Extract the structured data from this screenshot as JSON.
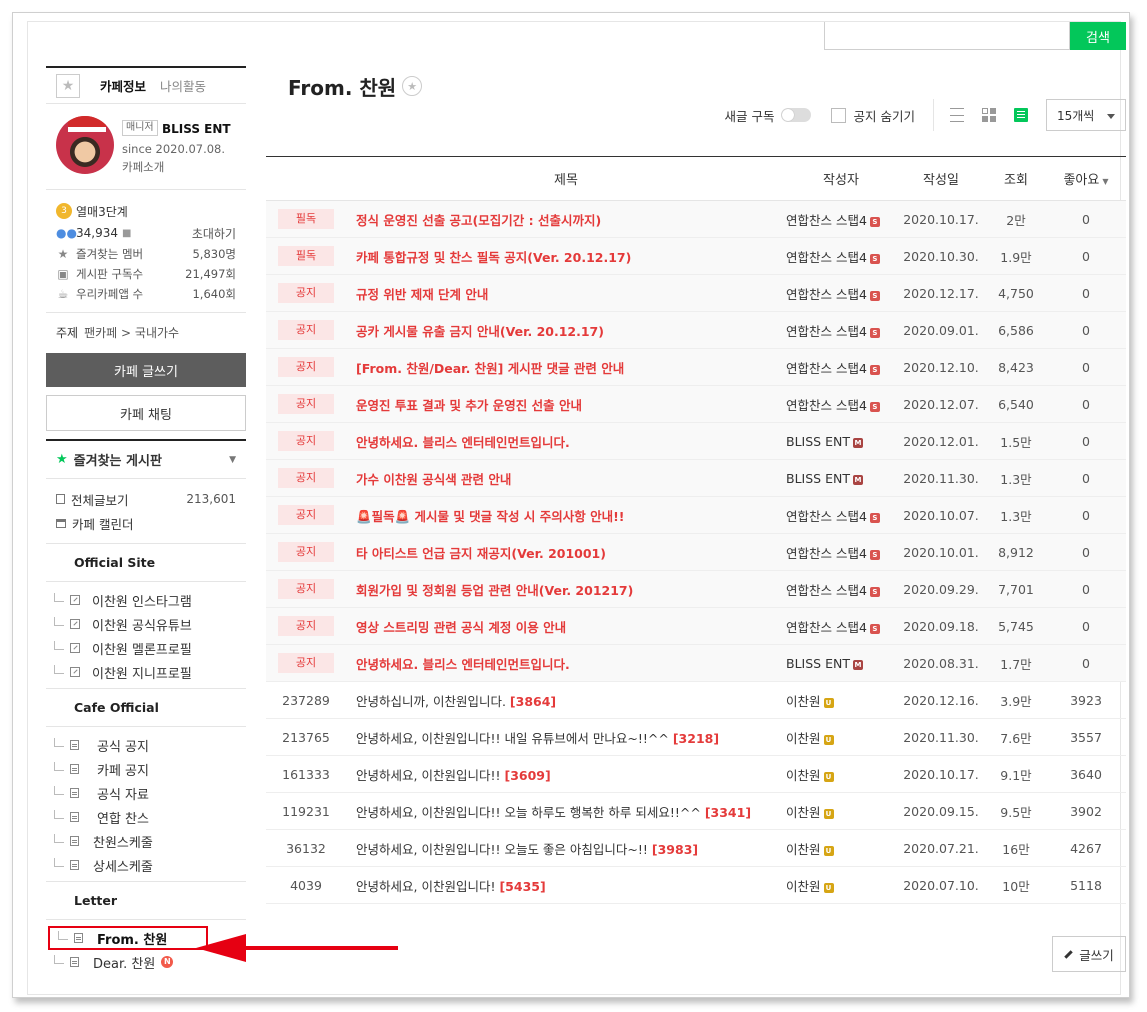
{
  "search": {
    "button_label": "검색",
    "placeholder": ""
  },
  "sidebar": {
    "tabs": {
      "info": "카페정보",
      "activity": "나의활동"
    },
    "profile": {
      "badge": "매니저",
      "name": "BLISS ENT",
      "since": "since 2020.07.08.",
      "intro": "카페소개"
    },
    "stats": {
      "level": "열매3단계",
      "members": "34,934",
      "invite": "초대하기",
      "fav_members_label": "즐겨찾는 멤버",
      "fav_members": "5,830명",
      "board_subs_label": "게시판 구독수",
      "board_subs": "21,497회",
      "app_users_label": "우리카페앱 수",
      "app_users": "1,640회"
    },
    "topic": {
      "key": "주제",
      "value": "팬카페 > 국내가수"
    },
    "write_button": "카페 글쓰기",
    "chat_button": "카페 채팅",
    "fav_boards": "즐겨찾는 게시판",
    "all_posts": {
      "label": "전체글보기",
      "count": "213,601"
    },
    "calendar": "카페 캘린더",
    "groups": [
      {
        "title": "Official Site",
        "items": [
          "이찬원 인스타그램",
          "이찬원 공식유튜브",
          "이찬원 멜론프로필",
          "이찬원 지니프로필"
        ]
      },
      {
        "title": "Cafe Official",
        "items": [
          "공식 공지",
          "카페 공지",
          "공식 자료",
          "연합 찬스",
          "찬원스케줄",
          "상세스케줄"
        ]
      },
      {
        "title": "Letter",
        "items": [
          "From. 찬원",
          "Dear. 찬원"
        ]
      }
    ],
    "new_badge": "N"
  },
  "main": {
    "title": "From. 찬원",
    "toolbar": {
      "subscribe": "새글 구독",
      "hide_notice": "공지 숨기기",
      "per_page": "15개씩"
    },
    "columns": {
      "subject": "제목",
      "author": "작성자",
      "date": "작성일",
      "views": "조회",
      "likes": "좋아요"
    },
    "notices": [
      {
        "tag": "필독",
        "subject": "정식 운영진 선출 공고(모집기간 : 선출시까지)",
        "author": "연합찬스 스탭4",
        "date": "2020.10.17.",
        "views": "2만",
        "likes": "0"
      },
      {
        "tag": "필독",
        "subject": "카페 통합규정 및 찬스 필독 공지(Ver. 20.12.17)",
        "author": "연합찬스 스탭4",
        "date": "2020.10.30.",
        "views": "1.9만",
        "likes": "0"
      },
      {
        "tag": "공지",
        "subject": "규정 위반 제재 단계 안내",
        "author": "연합찬스 스탭4",
        "date": "2020.12.17.",
        "views": "4,750",
        "likes": "0"
      },
      {
        "tag": "공지",
        "subject": "공카 게시물 유출 금지 안내(Ver. 20.12.17)",
        "author": "연합찬스 스탭4",
        "date": "2020.09.01.",
        "views": "6,586",
        "likes": "0"
      },
      {
        "tag": "공지",
        "subject": "[From. 찬원/Dear. 찬원] 게시판 댓글 관련 안내",
        "author": "연합찬스 스탭4",
        "date": "2020.12.10.",
        "views": "8,423",
        "likes": "0"
      },
      {
        "tag": "공지",
        "subject": "운영진 투표 결과 및 추가 운영진 선출 안내",
        "author": "연합찬스 스탭4",
        "date": "2020.12.07.",
        "views": "6,540",
        "likes": "0"
      },
      {
        "tag": "공지",
        "subject": "안녕하세요. 블리스 엔터테인먼트입니다.",
        "author": "BLISS ENT",
        "date": "2020.12.01.",
        "views": "1.5만",
        "likes": "0"
      },
      {
        "tag": "공지",
        "subject": "가수 이찬원 공식색 관련 안내",
        "author": "BLISS ENT",
        "date": "2020.11.30.",
        "views": "1.3만",
        "likes": "0"
      },
      {
        "tag": "공지",
        "subject": "🚨필독🚨 게시물 및 댓글 작성 시 주의사항 안내!!",
        "author": "연합찬스 스탭4",
        "date": "2020.10.07.",
        "views": "1.3만",
        "likes": "0"
      },
      {
        "tag": "공지",
        "subject": "타 아티스트 언급 금지 재공지(Ver. 201001)",
        "author": "연합찬스 스탭4",
        "date": "2020.10.01.",
        "views": "8,912",
        "likes": "0"
      },
      {
        "tag": "공지",
        "subject": "회원가입 및 정회원 등업 관련 안내(Ver. 201217)",
        "author": "연합찬스 스탭4",
        "date": "2020.09.29.",
        "views": "7,701",
        "likes": "0"
      },
      {
        "tag": "공지",
        "subject": "영상 스트리밍 관련 공식 계정 이용 안내",
        "author": "연합찬스 스탭4",
        "date": "2020.09.18.",
        "views": "5,745",
        "likes": "0"
      },
      {
        "tag": "공지",
        "subject": "안녕하세요. 블리스 엔터테인먼트입니다.",
        "author": "BLISS ENT",
        "date": "2020.08.31.",
        "views": "1.7만",
        "likes": "0"
      }
    ],
    "posts": [
      {
        "num": "237289",
        "subject": "안녕하십니까, 이찬원입니다.",
        "comments": "[3864]",
        "author": "이찬원",
        "date": "2020.12.16.",
        "views": "3.9만",
        "likes": "3923"
      },
      {
        "num": "213765",
        "subject": "안녕하세요, 이찬원입니다!! 내일 유튜브에서 만나요~!!^^",
        "comments": "[3218]",
        "author": "이찬원",
        "date": "2020.11.30.",
        "views": "7.6만",
        "likes": "3557"
      },
      {
        "num": "161333",
        "subject": "안녕하세요, 이찬원입니다!!",
        "comments": "[3609]",
        "author": "이찬원",
        "date": "2020.10.17.",
        "views": "9.1만",
        "likes": "3640"
      },
      {
        "num": "119231",
        "subject": "안녕하세요, 이찬원입니다!! 오늘 하루도 행복한 하루 되세요!!^^",
        "comments": "[3341]",
        "author": "이찬원",
        "date": "2020.09.15.",
        "views": "9.5만",
        "likes": "3902"
      },
      {
        "num": "36132",
        "subject": "안녕하세요, 이찬원입니다!! 오늘도 좋은 아침입니다~!!",
        "comments": "[3983]",
        "author": "이찬원",
        "date": "2020.07.21.",
        "views": "16만",
        "likes": "4267"
      },
      {
        "num": "4039",
        "subject": "안녕하세요, 이찬원입니다!",
        "comments": "[5435]",
        "author": "이찬원",
        "date": "2020.07.10.",
        "views": "10만",
        "likes": "5118"
      }
    ],
    "write_post": "글쓰기"
  },
  "colors": {
    "accent_green": "#03c75a",
    "notice_red": "#e43a3a",
    "annotation_red": "#e60012"
  }
}
